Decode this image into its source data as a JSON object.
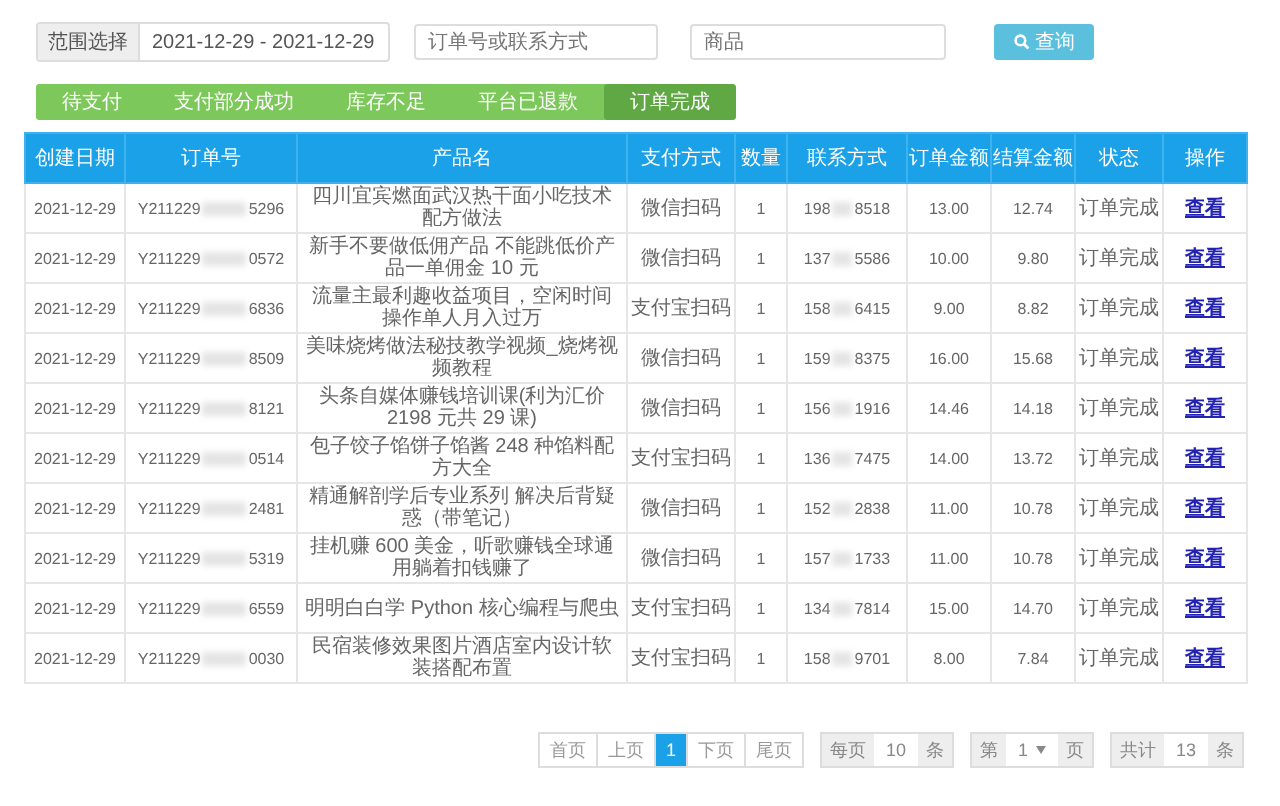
{
  "filters": {
    "range_label": "范围选择",
    "date_range": "2021-12-29 - 2021-12-29",
    "order_placeholder": "订单号或联系方式",
    "product_placeholder": "商品",
    "query_button": "查询"
  },
  "tabs": [
    {
      "label": "待支付",
      "selected": false
    },
    {
      "label": "支付部分成功",
      "selected": false
    },
    {
      "label": "库存不足",
      "selected": false
    },
    {
      "label": "平台已退款",
      "selected": false
    },
    {
      "label": "订单完成",
      "selected": true
    }
  ],
  "table": {
    "columns": [
      "创建日期",
      "订单号",
      "产品名",
      "支付方式",
      "数量",
      "联系方式",
      "订单金额",
      "结算金额",
      "状态",
      "操作"
    ],
    "rows": [
      {
        "date": "2021-12-29",
        "order": {
          "start": "Y211229",
          "end": "5296"
        },
        "product": "四川宜宾燃面武汉热干面小吃技术配方做法",
        "payment": "微信扫码",
        "qty": "1",
        "contact": {
          "start": "198",
          "end": "8518"
        },
        "amount": "13.00",
        "settled": "12.74",
        "status": "订单完成",
        "action": "查看"
      },
      {
        "date": "2021-12-29",
        "order": {
          "start": "Y211229",
          "end": "0572"
        },
        "product": "新手不要做低佣产品 不能跳低价产品一单佣金 10 元",
        "payment": "微信扫码",
        "qty": "1",
        "contact": {
          "start": "137",
          "end": "5586"
        },
        "amount": "10.00",
        "settled": "9.80",
        "status": "订单完成",
        "action": "查看"
      },
      {
        "date": "2021-12-29",
        "order": {
          "start": "Y211229",
          "end": "6836"
        },
        "product": "流量主最利趣收益项目，空闲时间操作单人月入过万",
        "payment": "支付宝扫码",
        "qty": "1",
        "contact": {
          "start": "158",
          "end": "6415"
        },
        "amount": "9.00",
        "settled": "8.82",
        "status": "订单完成",
        "action": "查看"
      },
      {
        "date": "2021-12-29",
        "order": {
          "start": "Y211229",
          "end": "8509"
        },
        "product": "美味烧烤做法秘技教学视频_烧烤视频教程",
        "payment": "微信扫码",
        "qty": "1",
        "contact": {
          "start": "159",
          "end": "8375"
        },
        "amount": "16.00",
        "settled": "15.68",
        "status": "订单完成",
        "action": "查看"
      },
      {
        "date": "2021-12-29",
        "order": {
          "start": "Y211229",
          "end": "8121"
        },
        "product": "头条自媒体赚钱培训课(利为汇价 2198 元共 29 课)",
        "payment": "微信扫码",
        "qty": "1",
        "contact": {
          "start": "156",
          "end": "1916"
        },
        "amount": "14.46",
        "settled": "14.18",
        "status": "订单完成",
        "action": "查看"
      },
      {
        "date": "2021-12-29",
        "order": {
          "start": "Y211229",
          "end": "0514"
        },
        "product": "包子饺子馅饼子馅酱 248 种馅料配方大全",
        "payment": "支付宝扫码",
        "qty": "1",
        "contact": {
          "start": "136",
          "end": "7475"
        },
        "amount": "14.00",
        "settled": "13.72",
        "status": "订单完成",
        "action": "查看"
      },
      {
        "date": "2021-12-29",
        "order": {
          "start": "Y211229",
          "end": "2481"
        },
        "product": "精通解剖学后专业系列 解决后背疑惑（带笔记）",
        "payment": "微信扫码",
        "qty": "1",
        "contact": {
          "start": "152",
          "end": "2838"
        },
        "amount": "11.00",
        "settled": "10.78",
        "status": "订单完成",
        "action": "查看"
      },
      {
        "date": "2021-12-29",
        "order": {
          "start": "Y211229",
          "end": "5319"
        },
        "product": "挂机赚 600 美金，听歌赚钱全球通用躺着扣钱赚了",
        "payment": "微信扫码",
        "qty": "1",
        "contact": {
          "start": "157",
          "end": "1733"
        },
        "amount": "11.00",
        "settled": "10.78",
        "status": "订单完成",
        "action": "查看"
      },
      {
        "date": "2021-12-29",
        "order": {
          "start": "Y211229",
          "end": "6559"
        },
        "product": "明明白白学 Python 核心编程与爬虫",
        "payment": "支付宝扫码",
        "qty": "1",
        "contact": {
          "start": "134",
          "end": "7814"
        },
        "amount": "15.00",
        "settled": "14.70",
        "status": "订单完成",
        "action": "查看"
      },
      {
        "date": "2021-12-29",
        "order": {
          "start": "Y211229",
          "end": "0030"
        },
        "product": "民宿装修效果图片酒店室内设计软装搭配布置",
        "payment": "支付宝扫码",
        "qty": "1",
        "contact": {
          "start": "158",
          "end": "9701"
        },
        "amount": "8.00",
        "settled": "7.84",
        "status": "订单完成",
        "action": "查看"
      }
    ]
  },
  "pagination": {
    "pages": [
      {
        "label": "首页",
        "selected": false
      },
      {
        "label": "上页",
        "selected": false
      },
      {
        "label": "1",
        "selected": true
      },
      {
        "label": "下页",
        "selected": false
      },
      {
        "label": "尾页",
        "selected": false
      }
    ],
    "per_page_label": "每页",
    "per_page": "10",
    "per_page_unit": "条",
    "page_label": "第",
    "page_select": "1",
    "page_unit": "页",
    "total_label": "共计",
    "total": "13",
    "total_unit": "条"
  }
}
